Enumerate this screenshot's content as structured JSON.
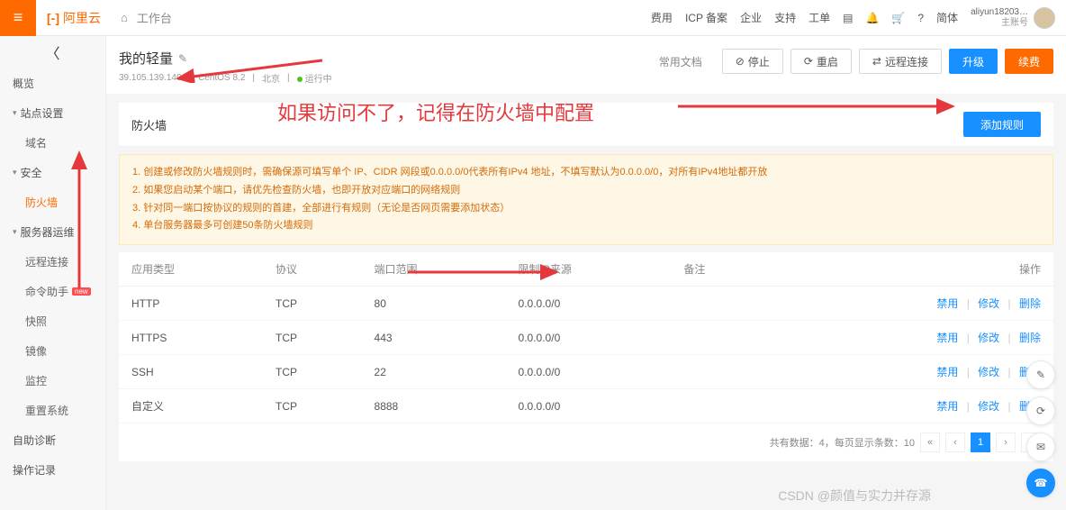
{
  "top": {
    "logo_text": "阿里云",
    "home": "",
    "workarea": "工作台",
    "links": [
      "费用",
      "ICP 备案",
      "企业",
      "支持",
      "工单",
      "简体"
    ],
    "user_name": "aliyun18203…",
    "user_sub": "主账号"
  },
  "sidebar": {
    "back": "",
    "items": [
      {
        "label": "概览",
        "caret": false,
        "l": 1
      },
      {
        "label": "站点设置",
        "caret": true,
        "l": 1
      },
      {
        "label": "域名",
        "caret": false,
        "l": 2
      },
      {
        "label": "安全",
        "caret": true,
        "l": 1
      },
      {
        "label": "防火墙",
        "caret": false,
        "l": 2,
        "active": true
      },
      {
        "label": "服务器运维",
        "caret": true,
        "l": 1
      },
      {
        "label": "远程连接",
        "caret": false,
        "l": 2
      },
      {
        "label": "命令助手",
        "caret": false,
        "l": 2,
        "badge": "new"
      },
      {
        "label": "快照",
        "caret": false,
        "l": 2
      },
      {
        "label": "镜像",
        "caret": false,
        "l": 2
      },
      {
        "label": "监控",
        "caret": false,
        "l": 2
      },
      {
        "label": "重置系统",
        "caret": false,
        "l": 2
      },
      {
        "label": "自助诊断",
        "caret": false,
        "l": 1
      },
      {
        "label": "操作记录",
        "caret": false,
        "l": 1
      }
    ]
  },
  "page": {
    "title": "我的轻量",
    "sub_ip": "39.105.139.140",
    "sub_os": "CentOS 8.2",
    "sub_region": "北京",
    "sub_state": "运行中",
    "actions": {
      "docs": "常用文档",
      "stop": "停止",
      "restart": "重启",
      "remote": "远程连接",
      "upgrade": "升级",
      "renew": "续费"
    },
    "card_title": "防火墙",
    "add_rule": "添加规则"
  },
  "notice": [
    "1. 创建或修改防火墙规则时，需确保源可填写单个 IP、CIDR 网段或0.0.0.0/0代表所有IPv4 地址，不填写默认为0.0.0.0/0，对所有IPv4地址都开放",
    "2. 如果您启动某个端口，请优先检查防火墙，也即开放对应端口的网络规则",
    "3. 针对同一端口按协议的规则的首建，全部进行有规则（无论是否网页需要添加状态）",
    "4. 单台服务器最多可创建50条防火墙规则"
  ],
  "table": {
    "cols": [
      "应用类型",
      "协议",
      "端口范围",
      "限制IP来源",
      "备注",
      "操作"
    ],
    "rows": [
      {
        "app": "HTTP",
        "proto": "TCP",
        "port": "80",
        "src": "0.0.0.0/0",
        "note": ""
      },
      {
        "app": "HTTPS",
        "proto": "TCP",
        "port": "443",
        "src": "0.0.0.0/0",
        "note": ""
      },
      {
        "app": "SSH",
        "proto": "TCP",
        "port": "22",
        "src": "0.0.0.0/0",
        "note": ""
      },
      {
        "app": "自定义",
        "proto": "TCP",
        "port": "8888",
        "src": "0.0.0.0/0",
        "note": ""
      }
    ],
    "act": {
      "disable": "禁用",
      "edit": "修改",
      "delete": "删除"
    }
  },
  "pager": {
    "total": "共有数据：4，每页显示条数：10"
  },
  "annot": "如果访问不了，记得在防火墙中配置",
  "watermark": "CSDN @颜值与实力并存源"
}
